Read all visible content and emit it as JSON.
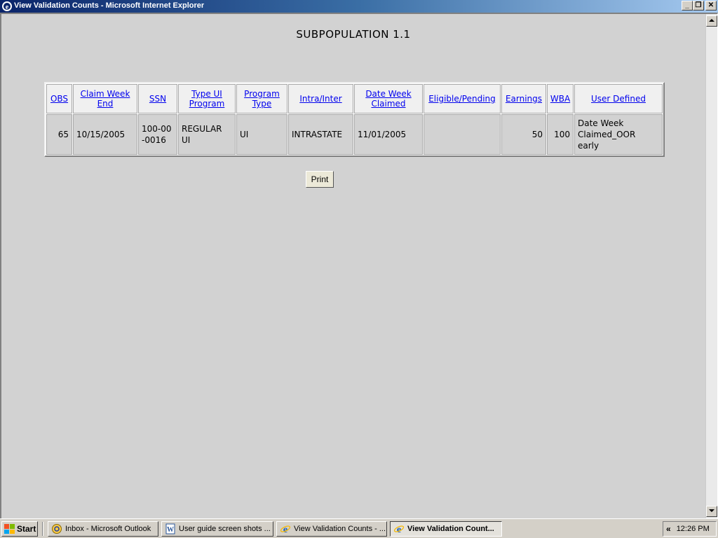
{
  "window": {
    "title": "View Validation Counts - Microsoft Internet Explorer",
    "min_label": "_",
    "max_label": "❐",
    "close_label": "✕"
  },
  "page": {
    "heading": "SUBPOPULATION 1.1",
    "print_label": "Print"
  },
  "table": {
    "headers": [
      "OBS",
      "Claim Week End",
      "SSN",
      "Type UI Program",
      "Program Type",
      "Intra/Inter",
      "Date Week Claimed",
      "Eligible/Pending",
      "Earnings",
      "WBA",
      "User Defined"
    ],
    "rows": [
      [
        "65",
        "10/15/2005",
        "100-00-0016",
        "REGULAR UI",
        "UI",
        "INTRASTATE",
        "11/01/2005",
        "",
        "50",
        "100",
        "Date Week Claimed_OOR early"
      ]
    ]
  },
  "taskbar": {
    "start_label": "Start",
    "tasks": [
      {
        "label": "Inbox - Microsoft Outlook",
        "icon": "outlook-icon"
      },
      {
        "label": "User guide screen shots ...",
        "icon": "word-icon"
      },
      {
        "label": "View Validation Counts - ...",
        "icon": "ie-icon"
      },
      {
        "label": "View Validation Count...",
        "icon": "ie-icon"
      }
    ],
    "tray_expand": "«",
    "clock": "12:26 PM"
  },
  "colors": {
    "titlebar": "#0a246a",
    "link": "#0000ee",
    "page_background": "#d2d2d2"
  }
}
